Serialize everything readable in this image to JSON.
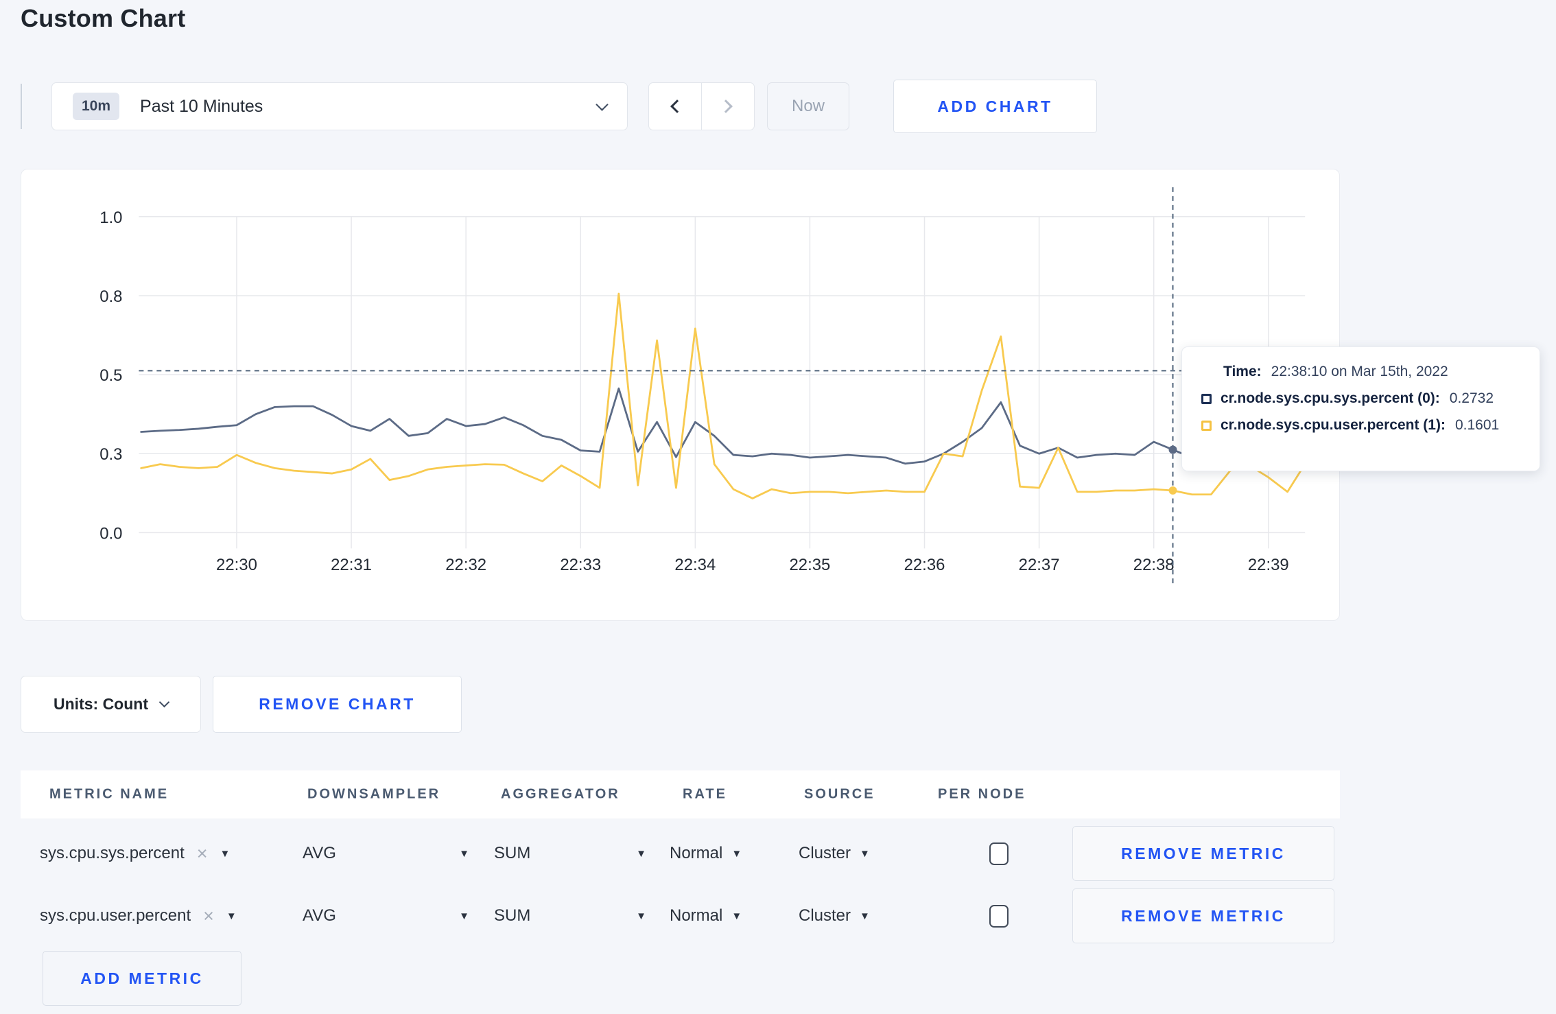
{
  "page": {
    "title": "Custom Chart"
  },
  "toolbar": {
    "time_badge": "10m",
    "time_label": "Past 10 Minutes",
    "now_label": "Now",
    "add_chart_label": "ADD CHART"
  },
  "chart_data": {
    "type": "line",
    "title": "",
    "x_start_label": "22:29:10",
    "interval_seconds": 10,
    "x_tick_labels": [
      "22:30",
      "22:31",
      "22:32",
      "22:33",
      "22:34",
      "22:35",
      "22:36",
      "22:37",
      "22:38",
      "22:39"
    ],
    "y_tick_labels": [
      "1.0",
      "0.8",
      "0.5",
      "0.3",
      "0.0"
    ],
    "y_tick_values": [
      1.0,
      0.8,
      0.5,
      0.3,
      0.0
    ],
    "grid": true,
    "legend_position": "tooltip",
    "series": [
      {
        "name": "cr.node.sys.cpu.sys.percent (0)",
        "color": "#5c6b86",
        "values": [
          0.355,
          0.358,
          0.36,
          0.363,
          0.368,
          0.372,
          0.4,
          0.418,
          0.42,
          0.42,
          0.398,
          0.37,
          0.358,
          0.388,
          0.345,
          0.352,
          0.388,
          0.37,
          0.375,
          0.392,
          0.372,
          0.345,
          0.335,
          0.308,
          0.305,
          0.465,
          0.305,
          0.38,
          0.287,
          0.38,
          0.345,
          0.295,
          0.29,
          0.3,
          0.295,
          0.285,
          0.29,
          0.295,
          0.29,
          0.285,
          0.262,
          0.27,
          0.3,
          0.33,
          0.365,
          0.43,
          0.32,
          0.3,
          0.315,
          0.285,
          0.295,
          0.3,
          0.295,
          0.33,
          0.31,
          0.285,
          0.3,
          0.305,
          0.295,
          0.305,
          0.295,
          0.305
        ]
      },
      {
        "name": "cr.node.sys.cpu.user.percent (1)",
        "color": "#f8ca4f",
        "values": [
          0.245,
          0.26,
          0.25,
          0.245,
          0.25,
          0.295,
          0.265,
          0.245,
          0.235,
          0.23,
          0.225,
          0.24,
          0.28,
          0.2,
          0.215,
          0.24,
          0.25,
          0.255,
          0.26,
          0.258,
          0.225,
          0.195,
          0.255,
          0.215,
          0.17,
          0.805,
          0.18,
          0.63,
          0.17,
          0.675,
          0.26,
          0.165,
          0.13,
          0.165,
          0.15,
          0.155,
          0.155,
          0.15,
          0.155,
          0.16,
          0.155,
          0.155,
          0.3,
          0.29,
          0.46,
          0.645,
          0.175,
          0.17,
          0.315,
          0.155,
          0.155,
          0.16,
          0.16,
          0.165,
          0.1601,
          0.145,
          0.145,
          0.235,
          0.255,
          0.21,
          0.155,
          0.27
        ]
      }
    ],
    "crosshair": {
      "time": "22:38:10",
      "point_index": 54,
      "cursor_value": 0.515
    }
  },
  "tooltip": {
    "time_label": "Time:",
    "time_value": "22:38:10 on Mar 15th, 2022",
    "series": [
      {
        "label": "cr.node.sys.cpu.sys.percent (0):",
        "value": "0.2732",
        "swatch_color": "#1c2f55"
      },
      {
        "label": "cr.node.sys.cpu.user.percent (1):",
        "value": "0.1601",
        "swatch_color": "#f5c242"
      }
    ]
  },
  "chart_controls": {
    "units_label": "Units: Count",
    "remove_chart_label": "REMOVE CHART"
  },
  "metrics_table": {
    "headers": [
      "METRIC NAME",
      "DOWNSAMPLER",
      "AGGREGATOR",
      "RATE",
      "SOURCE",
      "PER NODE"
    ],
    "close_glyph": "×",
    "caret_glyph": "▼",
    "rows": [
      {
        "metric_name": "sys.cpu.sys.percent",
        "downsampler": "AVG",
        "aggregator": "SUM",
        "rate": "Normal",
        "source": "Cluster",
        "per_node_checked": false,
        "remove_label": "REMOVE METRIC"
      },
      {
        "metric_name": "sys.cpu.user.percent",
        "downsampler": "AVG",
        "aggregator": "SUM",
        "rate": "Normal",
        "source": "Cluster",
        "per_node_checked": false,
        "remove_label": "REMOVE METRIC"
      }
    ],
    "add_metric_label": "ADD METRIC"
  }
}
